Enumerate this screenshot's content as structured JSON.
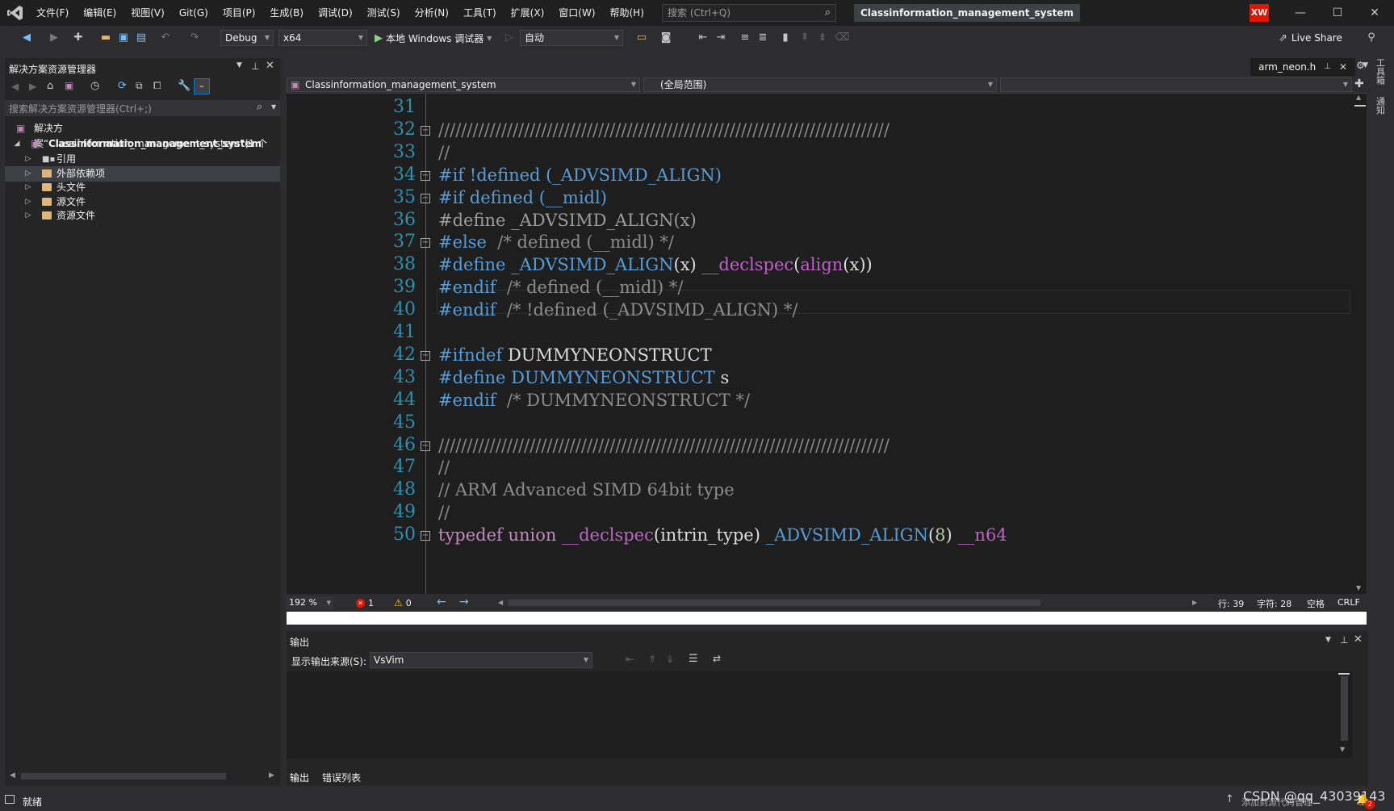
{
  "menu": [
    "文件(F)",
    "编辑(E)",
    "视图(V)",
    "Git(G)",
    "项目(P)",
    "生成(B)",
    "调试(D)",
    "测试(S)",
    "分析(N)",
    "工具(T)",
    "扩展(X)",
    "窗口(W)",
    "帮助(H)"
  ],
  "search": {
    "placeholder": "搜索 (Ctrl+Q)"
  },
  "solution_title": "Classinformation_management_system",
  "user_initials": "XW",
  "toolbar": {
    "config": "Debug",
    "platform": "x64",
    "run_label": "本地 Windows 调试器",
    "auto": "自动",
    "live_share": "Live Share"
  },
  "solution_explorer": {
    "title": "解决方案资源管理器",
    "search_placeholder": "搜索解决方案资源管理器(Ctrl+;)",
    "solution_node": "解决方案“Classinformation_management_system”(1 个",
    "project_node": "Classinformation_management_system",
    "items": [
      "引用",
      "外部依赖项",
      "头文件",
      "源文件",
      "资源文件"
    ]
  },
  "editor": {
    "tab_name": "arm_neon.h",
    "nav_project": "Classinformation_management_system",
    "nav_scope": "(全局范围)",
    "lines": [
      {
        "n": "31",
        "segs": [
          {
            "t": "",
            "c": "plain"
          }
        ]
      },
      {
        "n": "32",
        "fold": true,
        "segs": [
          {
            "t": "///////////////////////////////////////////////////////////////////////////////",
            "c": "cmt"
          }
        ]
      },
      {
        "n": "33",
        "segs": [
          {
            "t": "//",
            "c": "cmt"
          }
        ]
      },
      {
        "n": "34",
        "fold": true,
        "segs": [
          {
            "t": "#if ",
            "c": "kw-blue"
          },
          {
            "t": "!defined (_ADVSIMD_ALIGN)",
            "c": "kw-blue"
          }
        ]
      },
      {
        "n": "35",
        "fold": true,
        "segs": [
          {
            "t": "#if defined (__midl)",
            "c": "kw-blue"
          }
        ]
      },
      {
        "n": "36",
        "segs": [
          {
            "t": "#define _ADVSIMD_ALIGN(x)",
            "c": "kw-pp"
          }
        ]
      },
      {
        "n": "37",
        "fold": true,
        "segs": [
          {
            "t": "#else",
            "c": "kw-blue"
          },
          {
            "t": "  /* defined (__midl) */",
            "c": "cmt"
          }
        ]
      },
      {
        "n": "38",
        "segs": [
          {
            "t": "#define ",
            "c": "kw-blue"
          },
          {
            "t": "_ADVSIMD_ALIGN",
            "c": "kw-blue"
          },
          {
            "t": "(x) ",
            "c": "plain"
          },
          {
            "t": "__declspec",
            "c": "macro"
          },
          {
            "t": "(",
            "c": "plain"
          },
          {
            "t": "align",
            "c": "macro"
          },
          {
            "t": "(x))",
            "c": "plain"
          }
        ]
      },
      {
        "n": "39",
        "segs": [
          {
            "t": "#endif",
            "c": "kw-blue"
          },
          {
            "t": "  /* defined (__midl) */",
            "c": "cmt"
          }
        ]
      },
      {
        "n": "40",
        "segs": [
          {
            "t": "#endif",
            "c": "kw-blue"
          },
          {
            "t": "  /* !defined (_ADVSIMD_ALIGN) */",
            "c": "cmt"
          }
        ]
      },
      {
        "n": "41",
        "segs": [
          {
            "t": "",
            "c": "plain"
          }
        ]
      },
      {
        "n": "42",
        "fold": true,
        "segs": [
          {
            "t": "#ifndef ",
            "c": "kw-blue"
          },
          {
            "t": "DUMMYNEONSTRUCT",
            "c": "plain"
          }
        ]
      },
      {
        "n": "43",
        "segs": [
          {
            "t": "#define ",
            "c": "kw-blue"
          },
          {
            "t": "DUMMYNEONSTRUCT",
            "c": "kw-blue"
          },
          {
            "t": " s",
            "c": "plain"
          }
        ]
      },
      {
        "n": "44",
        "segs": [
          {
            "t": "#endif",
            "c": "kw-blue"
          },
          {
            "t": "  /* DUMMYNEONSTRUCT */",
            "c": "cmt"
          }
        ]
      },
      {
        "n": "45",
        "segs": [
          {
            "t": "",
            "c": "plain"
          }
        ]
      },
      {
        "n": "46",
        "fold": true,
        "segs": [
          {
            "t": "///////////////////////////////////////////////////////////////////////////////",
            "c": "cmt"
          }
        ]
      },
      {
        "n": "47",
        "segs": [
          {
            "t": "//",
            "c": "cmt"
          }
        ]
      },
      {
        "n": "48",
        "segs": [
          {
            "t": "// ARM Advanced SIMD 64bit type",
            "c": "cmt"
          }
        ]
      },
      {
        "n": "49",
        "segs": [
          {
            "t": "//",
            "c": "cmt"
          }
        ]
      },
      {
        "n": "50",
        "fold": true,
        "segs": [
          {
            "t": "typedef ",
            "c": "kw-purple"
          },
          {
            "t": "union ",
            "c": "kw-purple"
          },
          {
            "t": "__declspec",
            "c": "macro"
          },
          {
            "t": "(intrin_type) ",
            "c": "plain"
          },
          {
            "t": "_ADVSIMD_ALIGN",
            "c": "kw-blue"
          },
          {
            "t": "(",
            "c": "plain"
          },
          {
            "t": "8",
            "c": "num"
          },
          {
            "t": ") ",
            "c": "plain"
          },
          {
            "t": "__n64",
            "c": "macro"
          }
        ]
      }
    ],
    "zoom": "192 %",
    "errors": "1",
    "warnings": "0",
    "pos_line": "行: 39",
    "pos_char": "字符: 28",
    "whitespace": "空格",
    "eol": "CRLF"
  },
  "output": {
    "title": "输出",
    "source_label": "显示输出来源(S):",
    "source_value": "VsVim",
    "tabs": [
      "输出",
      "错误列表"
    ]
  },
  "statusbar": {
    "ready": "就绪",
    "add_source": "添加到源代码管理",
    "watermark": "CSDN @qq_43039143",
    "notifications": "2"
  },
  "right_tools": [
    "工具箱",
    "通知"
  ],
  "colors": {
    "accent": "#007acc",
    "error": "#e51400",
    "avatar": "#e51400"
  }
}
